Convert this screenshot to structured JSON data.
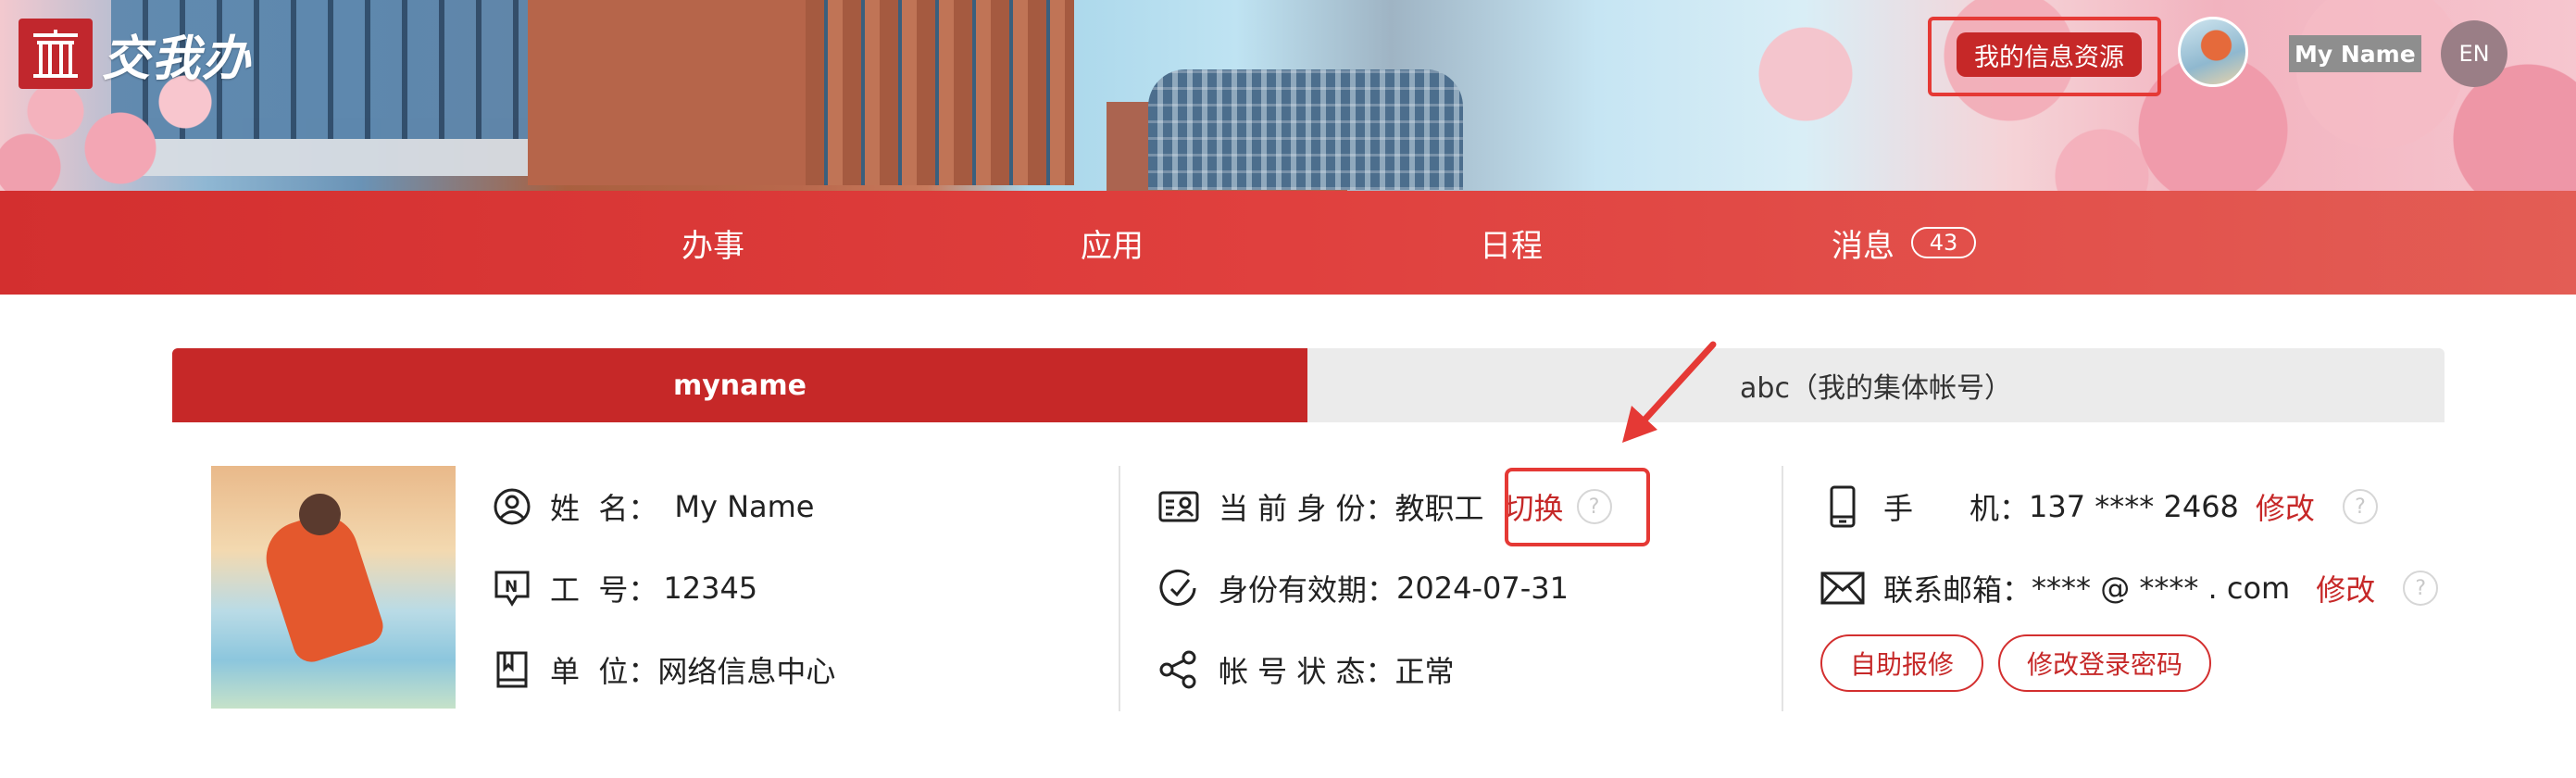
{
  "header": {
    "logo_text": "交我办",
    "my_info_resources": "我的信息资源",
    "username": "My Name",
    "language": "EN"
  },
  "nav": {
    "items": [
      {
        "label": "办事"
      },
      {
        "label": "应用"
      },
      {
        "label": "日程"
      },
      {
        "label": "消息",
        "badge": "43"
      }
    ]
  },
  "tabs": [
    {
      "label": "myname",
      "active": true
    },
    {
      "label": "abc（我的集体帐号）",
      "active": false
    }
  ],
  "profile": {
    "col1": {
      "name_label": "姓  名：",
      "name_value": "My Name",
      "id_label": "工  号：",
      "id_value": "12345",
      "unit_label": "单  位：",
      "unit_value": "网络信息中心"
    },
    "col2": {
      "identity_label": "当 前 身 份：",
      "identity_value": "教职工",
      "switch_label": "切换",
      "validity_label": "身份有效期：",
      "validity_value": "2024-07-31",
      "status_label": "帐 号 状 态：",
      "status_value": "正常"
    },
    "col3": {
      "phone_label": "手      机：",
      "phone_value": "137 **** 2468",
      "phone_edit": "修改",
      "email_label": "联系邮箱：",
      "email_value": "**** @ **** . com",
      "email_edit": "修改",
      "self_repair_button": "自助报修",
      "change_password_button": "修改登录密码"
    },
    "help_glyph": "?"
  },
  "colors": {
    "brand_red": "#c62828",
    "highlight_red": "#e53935"
  }
}
